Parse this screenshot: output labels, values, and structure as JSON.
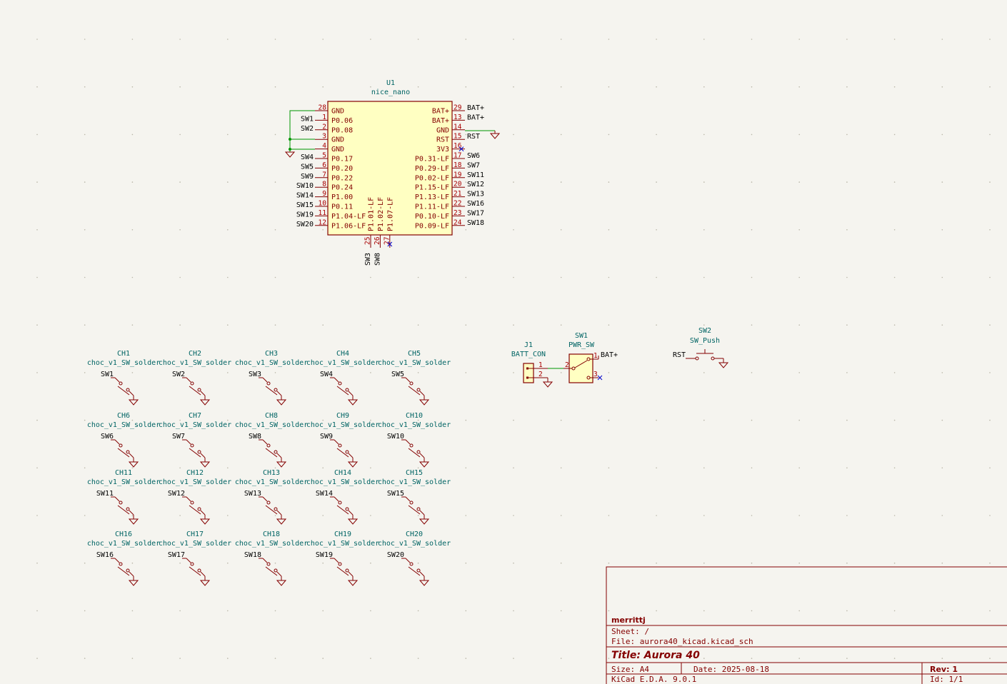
{
  "colors": {
    "background": "#f5f4ef",
    "body_fill": "#ffffc2",
    "body_stroke": "#840000",
    "wire": "#009600",
    "reference": "#006464",
    "no_connect": "#0000c8"
  },
  "u1": {
    "ref": "U1",
    "value": "nice_nano",
    "left_pins": [
      {
        "num": "28",
        "name": "GND",
        "net": ""
      },
      {
        "num": "1",
        "name": "P0.06",
        "net": "SW1"
      },
      {
        "num": "2",
        "name": "P0.08",
        "net": "SW2"
      },
      {
        "num": "3",
        "name": "GND",
        "net": ""
      },
      {
        "num": "4",
        "name": "GND",
        "net": ""
      },
      {
        "num": "5",
        "name": "P0.17",
        "net": "SW4"
      },
      {
        "num": "6",
        "name": "P0.20",
        "net": "SW5"
      },
      {
        "num": "7",
        "name": "P0.22",
        "net": "SW9"
      },
      {
        "num": "8",
        "name": "P0.24",
        "net": "SW10"
      },
      {
        "num": "9",
        "name": "P1.00",
        "net": "SW14"
      },
      {
        "num": "10",
        "name": "P0.11",
        "net": "SW15"
      },
      {
        "num": "11",
        "name": "P1.04-LF",
        "net": "SW19"
      },
      {
        "num": "12",
        "name": "P1.06-LF",
        "net": "SW20"
      }
    ],
    "right_pins": [
      {
        "num": "29",
        "name": "BAT+",
        "net": "BAT+"
      },
      {
        "num": "13",
        "name": "BAT+",
        "net": "BAT+"
      },
      {
        "num": "14",
        "name": "GND",
        "net": ""
      },
      {
        "num": "15",
        "name": "RST",
        "net": "RST"
      },
      {
        "num": "16",
        "name": "3V3",
        "net": ""
      },
      {
        "num": "17",
        "name": "P0.31-LF",
        "net": "SW6"
      },
      {
        "num": "18",
        "name": "P0.29-LF",
        "net": "SW7"
      },
      {
        "num": "19",
        "name": "P0.02-LF",
        "net": "SW11"
      },
      {
        "num": "20",
        "name": "P1.15-LF",
        "net": "SW12"
      },
      {
        "num": "21",
        "name": "P1.13-LF",
        "net": "SW13"
      },
      {
        "num": "22",
        "name": "P1.11-LF",
        "net": "SW16"
      },
      {
        "num": "23",
        "name": "P0.10-LF",
        "net": "SW17"
      },
      {
        "num": "24",
        "name": "P0.09-LF",
        "net": "SW18"
      }
    ],
    "bottom_pins": [
      {
        "num": "25",
        "name": "P1.01-LF",
        "net": "SW3"
      },
      {
        "num": "26",
        "name": "P1.02-LF",
        "net": "SW8"
      },
      {
        "num": "27",
        "name": "P1.07-LF",
        "net": ""
      }
    ]
  },
  "switches": [
    {
      "ref": "CH1",
      "value": "choc_v1_SW_solder",
      "net": "SW1"
    },
    {
      "ref": "CH2",
      "value": "choc_v1_SW_solder",
      "net": "SW2"
    },
    {
      "ref": "CH3",
      "value": "choc_v1_SW_solder",
      "net": "SW3"
    },
    {
      "ref": "CH4",
      "value": "choc_v1_SW_solder",
      "net": "SW4"
    },
    {
      "ref": "CH5",
      "value": "choc_v1_SW_solder",
      "net": "SW5"
    },
    {
      "ref": "CH6",
      "value": "choc_v1_SW_solder",
      "net": "SW6"
    },
    {
      "ref": "CH7",
      "value": "choc_v1_SW_solder",
      "net": "SW7"
    },
    {
      "ref": "CH8",
      "value": "choc_v1_SW_solder",
      "net": "SW8"
    },
    {
      "ref": "CH9",
      "value": "choc_v1_SW_solder",
      "net": "SW9"
    },
    {
      "ref": "CH10",
      "value": "choc_v1_SW_solder",
      "net": "SW10"
    },
    {
      "ref": "CH11",
      "value": "choc_v1_SW_solder",
      "net": "SW11"
    },
    {
      "ref": "CH12",
      "value": "choc_v1_SW_solder",
      "net": "SW12"
    },
    {
      "ref": "CH13",
      "value": "choc_v1_SW_solder",
      "net": "SW13"
    },
    {
      "ref": "CH14",
      "value": "choc_v1_SW_solder",
      "net": "SW14"
    },
    {
      "ref": "CH15",
      "value": "choc_v1_SW_solder",
      "net": "SW15"
    },
    {
      "ref": "CH16",
      "value": "choc_v1_SW_solder",
      "net": "SW16"
    },
    {
      "ref": "CH17",
      "value": "choc_v1_SW_solder",
      "net": "SW17"
    },
    {
      "ref": "CH18",
      "value": "choc_v1_SW_solder",
      "net": "SW18"
    },
    {
      "ref": "CH19",
      "value": "choc_v1_SW_solder",
      "net": "SW19"
    },
    {
      "ref": "CH20",
      "value": "choc_v1_SW_solder",
      "net": "SW20"
    }
  ],
  "j1": {
    "ref": "J1",
    "value": "BATT_CON",
    "pin1": "1",
    "pin2": "2"
  },
  "sw1": {
    "ref": "SW1",
    "value": "PWR_SW",
    "pin1": "1",
    "pin2": "2",
    "pin3": "3",
    "net": "BAT+"
  },
  "sw2": {
    "ref": "SW2",
    "value": "SW_Push",
    "net": "RST"
  },
  "title_block": {
    "company": "merrittj",
    "sheet": "Sheet: /",
    "file": "File: aurora40_kicad.kicad_sch",
    "title": "Title: Aurora 40",
    "size": "Size: A4",
    "date": "Date: 2025-08-18",
    "rev": "Rev: 1",
    "tool": "KiCad E.D.A. 9.0.1",
    "id": "Id: 1/1"
  }
}
